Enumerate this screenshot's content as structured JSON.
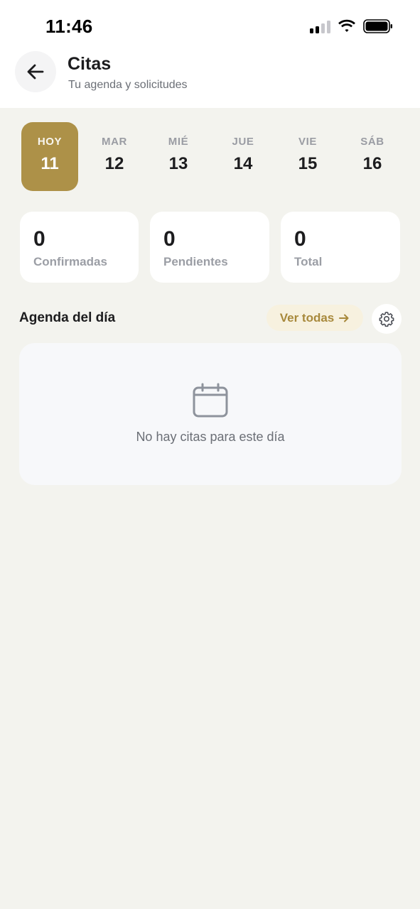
{
  "status_bar": {
    "time": "11:46",
    "icons": [
      "cellular-signal-icon",
      "wifi-icon",
      "battery-icon"
    ]
  },
  "header": {
    "back_icon": "arrow-left-icon",
    "title": "Citas",
    "subtitle": "Tu agenda y solicitudes"
  },
  "days": [
    {
      "name": "HOY",
      "number": "11",
      "selected": true
    },
    {
      "name": "MAR",
      "number": "12",
      "selected": false
    },
    {
      "name": "MIÉ",
      "number": "13",
      "selected": false
    },
    {
      "name": "JUE",
      "number": "14",
      "selected": false
    },
    {
      "name": "VIE",
      "number": "15",
      "selected": false
    },
    {
      "name": "SÁB",
      "number": "16",
      "selected": false
    }
  ],
  "stats": [
    {
      "value": "0",
      "label": "Confirmadas"
    },
    {
      "value": "0",
      "label": "Pendientes"
    },
    {
      "value": "0",
      "label": "Total"
    }
  ],
  "agenda": {
    "title": "Agenda del día",
    "view_all_label": "Ver todas",
    "view_all_icon": "arrow-right-icon",
    "settings_icon": "gear-icon",
    "empty_icon": "calendar-icon",
    "empty_text": "No hay citas para este día"
  },
  "colors": {
    "accent": "#ad9148",
    "background": "#f3f3ee",
    "accent_soft": "#f7f1df"
  }
}
